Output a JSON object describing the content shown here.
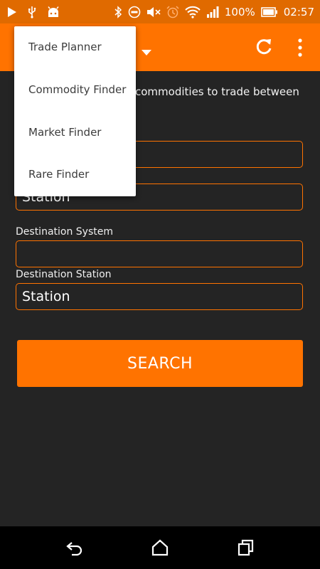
{
  "status_bar": {
    "battery_text": "100%",
    "time": "02:57",
    "icons": [
      "play-icon",
      "usb-icon",
      "android-icon",
      "bluetooth-icon",
      "do-not-disturb-icon",
      "mute-icon",
      "alarm-icon",
      "wifi-icon",
      "signal-icon",
      "battery-icon"
    ]
  },
  "action_bar": {
    "icons": [
      "dropdown-caret-icon",
      "refresh-icon",
      "overflow-menu-icon"
    ]
  },
  "description": "commodities to trade between",
  "form": {
    "source_station_placeholder": "Station",
    "destination_system_label": "Destination System",
    "destination_system_placeholder": "",
    "destination_station_label": "Destination Station",
    "destination_station_placeholder": "Station",
    "search_label": "SEARCH"
  },
  "dropdown": {
    "items": [
      {
        "label": "Trade Planner"
      },
      {
        "label": "Commodity Finder"
      },
      {
        "label": "Market Finder"
      },
      {
        "label": "Rare Finder"
      }
    ]
  },
  "colors": {
    "accent": "#ff7300",
    "status_bar": "#e06a00",
    "background": "#242424",
    "nav_bar": "#000000"
  }
}
